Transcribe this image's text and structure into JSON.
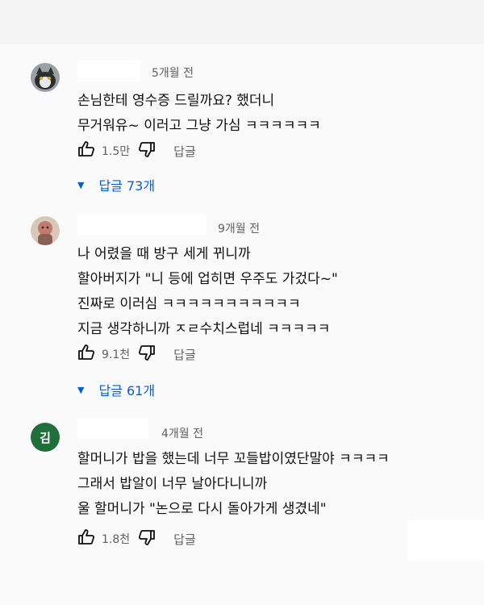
{
  "comments": [
    {
      "time": "5개월 전",
      "lines": [
        "손님한테 영수증 드릴까요? 했더니",
        "무거워유~ 이러고 그냥 가심 ㅋㅋㅋㅋㅋㅋ"
      ],
      "likes": "1.5만",
      "reply_label": "답글",
      "replies_label": "답글 73개"
    },
    {
      "time": "9개월 전",
      "lines": [
        "나 어렸을 때 방구 세게 뀌니까",
        "할아버지가 \"니 등에 업히면 우주도 가겄다~\"",
        "진짜로 이러심 ㅋㅋㅋㅋㅋㅋㅋㅋㅋㅋㅋ",
        "지금 생각하니까 ㅈㄹ수치스럽네 ㅋㅋㅋㅋㅋ"
      ],
      "likes": "9.1천",
      "reply_label": "답글",
      "replies_label": "답글 61개"
    },
    {
      "avatar_letter": "김",
      "time": "4개월 전",
      "lines": [
        "할머니가 밥을 했는데 너무 꼬들밥이였단말야 ㅋㅋㅋㅋ",
        "그래서 밥알이 너무 날아다니니까",
        "울 할머니가 \"논으로 다시 돌아가게 생겼네\""
      ],
      "likes": "1.8천",
      "reply_label": "답글"
    }
  ],
  "icons": {
    "like": "thumbs-up-icon",
    "dislike": "thumbs-down-icon",
    "expand": "caret-down-icon"
  },
  "colors": {
    "link_blue": "#065fd4",
    "meta_gray": "#606060",
    "avatar_green": "#1f6f3a"
  }
}
